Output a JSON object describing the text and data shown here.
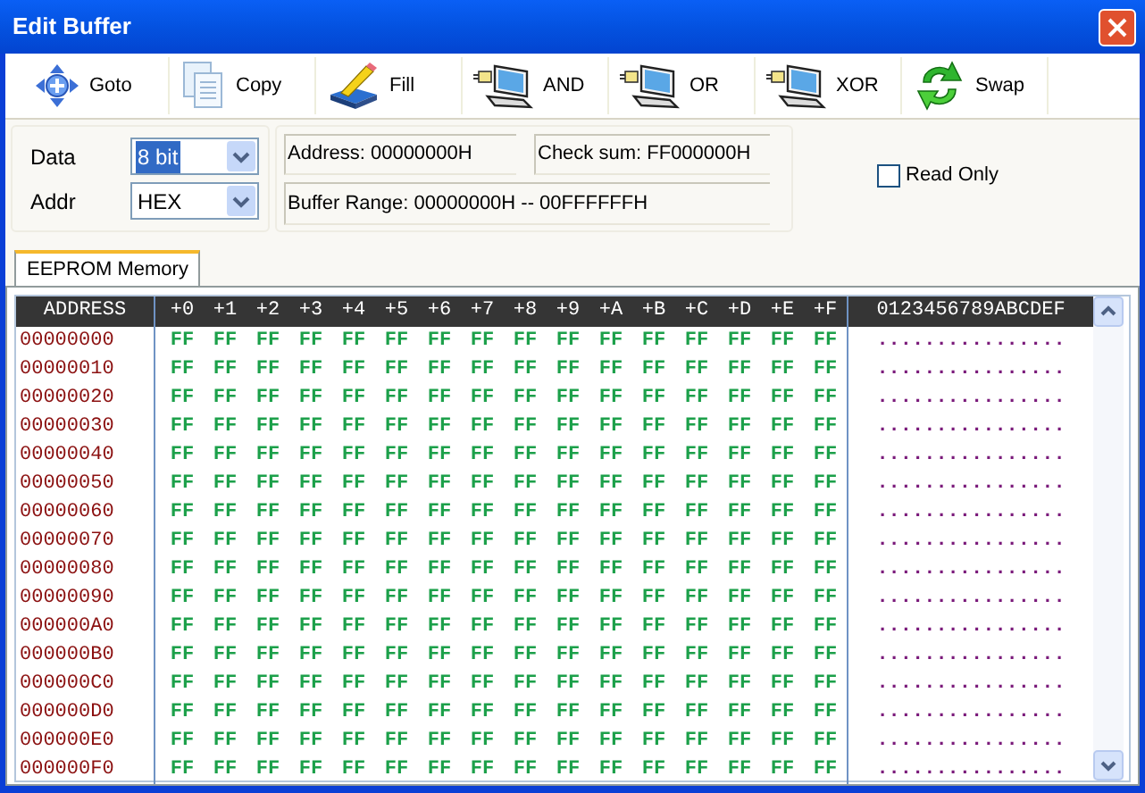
{
  "window": {
    "title": "Edit Buffer"
  },
  "toolbar": [
    {
      "label": "Goto",
      "kind": "move"
    },
    {
      "label": "Copy",
      "kind": "copy"
    },
    {
      "label": "Fill",
      "kind": "fill"
    },
    {
      "label": "AND",
      "kind": "logic"
    },
    {
      "label": "OR",
      "kind": "logic"
    },
    {
      "label": "XOR",
      "kind": "logic"
    },
    {
      "label": "Swap",
      "kind": "swap"
    }
  ],
  "data_select": {
    "label": "Data",
    "value": "8 bit",
    "focused": true
  },
  "addr_select": {
    "label": "Addr",
    "value": "HEX",
    "focused": false
  },
  "info": {
    "address": "Address: 00000000H",
    "checksum": "Check sum: FF000000H",
    "range": "Buffer Range: 00000000H -- 00FFFFFFH"
  },
  "read_only": {
    "label": "Read Only",
    "checked": false
  },
  "tabs": [
    {
      "label": "EEPROM Memory",
      "selected": true
    }
  ],
  "grid": {
    "address_header": "ADDRESS",
    "offsets": [
      "+0",
      "+1",
      "+2",
      "+3",
      "+4",
      "+5",
      "+6",
      "+7",
      "+8",
      "+9",
      "+A",
      "+B",
      "+C",
      "+D",
      "+E",
      "+F"
    ],
    "ascii_header": "0123456789ABCDEF",
    "rows": [
      {
        "address": "00000000",
        "bytes": [
          "FF",
          "FF",
          "FF",
          "FF",
          "FF",
          "FF",
          "FF",
          "FF",
          "FF",
          "FF",
          "FF",
          "FF",
          "FF",
          "FF",
          "FF",
          "FF"
        ],
        "ascii": "................"
      },
      {
        "address": "00000010",
        "bytes": [
          "FF",
          "FF",
          "FF",
          "FF",
          "FF",
          "FF",
          "FF",
          "FF",
          "FF",
          "FF",
          "FF",
          "FF",
          "FF",
          "FF",
          "FF",
          "FF"
        ],
        "ascii": "................"
      },
      {
        "address": "00000020",
        "bytes": [
          "FF",
          "FF",
          "FF",
          "FF",
          "FF",
          "FF",
          "FF",
          "FF",
          "FF",
          "FF",
          "FF",
          "FF",
          "FF",
          "FF",
          "FF",
          "FF"
        ],
        "ascii": "................"
      },
      {
        "address": "00000030",
        "bytes": [
          "FF",
          "FF",
          "FF",
          "FF",
          "FF",
          "FF",
          "FF",
          "FF",
          "FF",
          "FF",
          "FF",
          "FF",
          "FF",
          "FF",
          "FF",
          "FF"
        ],
        "ascii": "................"
      },
      {
        "address": "00000040",
        "bytes": [
          "FF",
          "FF",
          "FF",
          "FF",
          "FF",
          "FF",
          "FF",
          "FF",
          "FF",
          "FF",
          "FF",
          "FF",
          "FF",
          "FF",
          "FF",
          "FF"
        ],
        "ascii": "................"
      },
      {
        "address": "00000050",
        "bytes": [
          "FF",
          "FF",
          "FF",
          "FF",
          "FF",
          "FF",
          "FF",
          "FF",
          "FF",
          "FF",
          "FF",
          "FF",
          "FF",
          "FF",
          "FF",
          "FF"
        ],
        "ascii": "................"
      },
      {
        "address": "00000060",
        "bytes": [
          "FF",
          "FF",
          "FF",
          "FF",
          "FF",
          "FF",
          "FF",
          "FF",
          "FF",
          "FF",
          "FF",
          "FF",
          "FF",
          "FF",
          "FF",
          "FF"
        ],
        "ascii": "................"
      },
      {
        "address": "00000070",
        "bytes": [
          "FF",
          "FF",
          "FF",
          "FF",
          "FF",
          "FF",
          "FF",
          "FF",
          "FF",
          "FF",
          "FF",
          "FF",
          "FF",
          "FF",
          "FF",
          "FF"
        ],
        "ascii": "................"
      },
      {
        "address": "00000080",
        "bytes": [
          "FF",
          "FF",
          "FF",
          "FF",
          "FF",
          "FF",
          "FF",
          "FF",
          "FF",
          "FF",
          "FF",
          "FF",
          "FF",
          "FF",
          "FF",
          "FF"
        ],
        "ascii": "................"
      },
      {
        "address": "00000090",
        "bytes": [
          "FF",
          "FF",
          "FF",
          "FF",
          "FF",
          "FF",
          "FF",
          "FF",
          "FF",
          "FF",
          "FF",
          "FF",
          "FF",
          "FF",
          "FF",
          "FF"
        ],
        "ascii": "................"
      },
      {
        "address": "000000A0",
        "bytes": [
          "FF",
          "FF",
          "FF",
          "FF",
          "FF",
          "FF",
          "FF",
          "FF",
          "FF",
          "FF",
          "FF",
          "FF",
          "FF",
          "FF",
          "FF",
          "FF"
        ],
        "ascii": "................"
      },
      {
        "address": "000000B0",
        "bytes": [
          "FF",
          "FF",
          "FF",
          "FF",
          "FF",
          "FF",
          "FF",
          "FF",
          "FF",
          "FF",
          "FF",
          "FF",
          "FF",
          "FF",
          "FF",
          "FF"
        ],
        "ascii": "................"
      },
      {
        "address": "000000C0",
        "bytes": [
          "FF",
          "FF",
          "FF",
          "FF",
          "FF",
          "FF",
          "FF",
          "FF",
          "FF",
          "FF",
          "FF",
          "FF",
          "FF",
          "FF",
          "FF",
          "FF"
        ],
        "ascii": "................"
      },
      {
        "address": "000000D0",
        "bytes": [
          "FF",
          "FF",
          "FF",
          "FF",
          "FF",
          "FF",
          "FF",
          "FF",
          "FF",
          "FF",
          "FF",
          "FF",
          "FF",
          "FF",
          "FF",
          "FF"
        ],
        "ascii": "................"
      },
      {
        "address": "000000E0",
        "bytes": [
          "FF",
          "FF",
          "FF",
          "FF",
          "FF",
          "FF",
          "FF",
          "FF",
          "FF",
          "FF",
          "FF",
          "FF",
          "FF",
          "FF",
          "FF",
          "FF"
        ],
        "ascii": "................"
      },
      {
        "address": "000000F0",
        "bytes": [
          "FF",
          "FF",
          "FF",
          "FF",
          "FF",
          "FF",
          "FF",
          "FF",
          "FF",
          "FF",
          "FF",
          "FF",
          "FF",
          "FF",
          "FF",
          "FF"
        ],
        "ascii": "................"
      }
    ]
  }
}
